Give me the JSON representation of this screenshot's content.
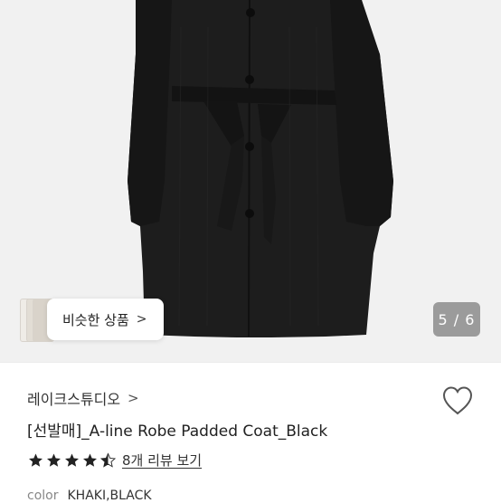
{
  "gallery": {
    "counter": "5 / 6",
    "similar_button": "비슷한 상품",
    "similar_chevron": ">",
    "background_color": "#f1f1f1",
    "coat_color": "#1d1d1d"
  },
  "product": {
    "shop_name": "레이크스튜디오",
    "shop_chevron": ">",
    "title": "[선발매]_A-line Robe Padded Coat_Black",
    "rating": 4.5,
    "review_link": "8개 리뷰 보기",
    "color_label": "color",
    "color_value": "KHAKI,BLACK"
  },
  "icons": {
    "wishlist": "heart-outline-icon",
    "star": "star-icon"
  }
}
